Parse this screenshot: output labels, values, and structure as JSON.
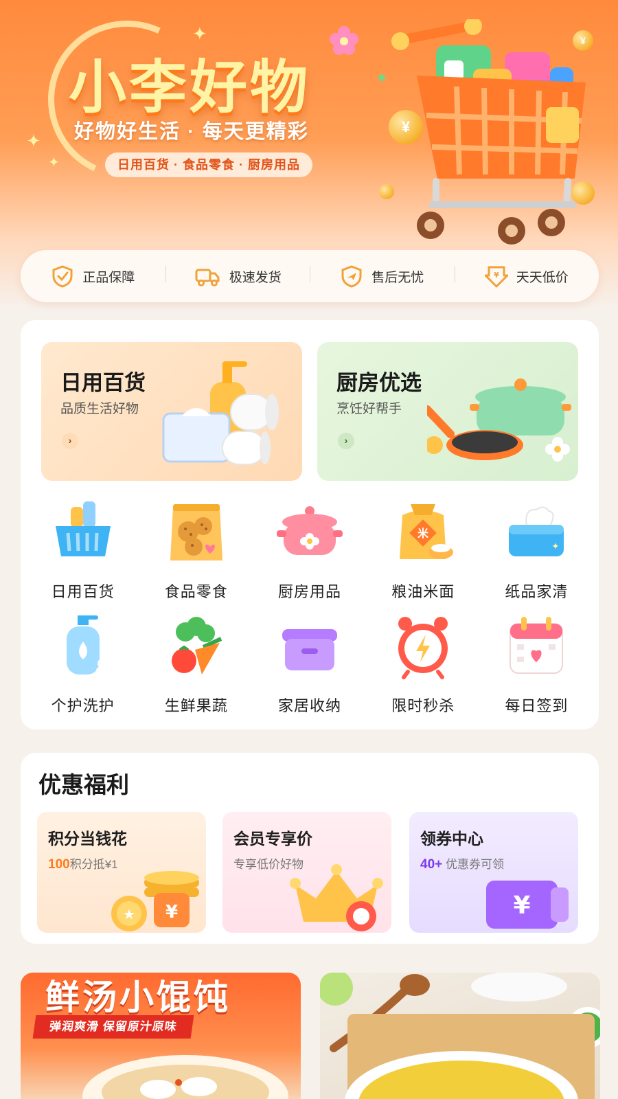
{
  "hero": {
    "title": "小李好物",
    "slogan": "好物好生活 · 每天更精彩",
    "tagline": "日用百货 · 食品零食 · 厨房用品",
    "coin_symbol": "¥"
  },
  "guarantees": [
    {
      "label": "正品保障",
      "icon": "shield-check-icon"
    },
    {
      "label": "极速发货",
      "icon": "truck-icon"
    },
    {
      "label": "售后无忧",
      "icon": "shield-plane-icon"
    },
    {
      "label": "天天低价",
      "icon": "price-down-icon"
    }
  ],
  "featured": [
    {
      "title": "日用百货",
      "subtitle": "品质生活好物",
      "arrow": "›"
    },
    {
      "title": "厨房优选",
      "subtitle": "烹饪好帮手",
      "arrow": "›"
    }
  ],
  "categories": [
    {
      "label": "日用百货",
      "icon": "basket-icon"
    },
    {
      "label": "食品零食",
      "icon": "cookie-bag-icon"
    },
    {
      "label": "厨房用品",
      "icon": "cooking-pot-icon"
    },
    {
      "label": "粮油米面",
      "icon": "rice-sack-icon"
    },
    {
      "label": "纸品家清",
      "icon": "tissue-box-icon"
    },
    {
      "label": "个护洗护",
      "icon": "pump-bottle-icon"
    },
    {
      "label": "生鲜果蔬",
      "icon": "vegetables-icon"
    },
    {
      "label": "家居收纳",
      "icon": "storage-box-icon"
    },
    {
      "label": "限时秒杀",
      "icon": "alarm-clock-icon"
    },
    {
      "label": "每日签到",
      "icon": "calendar-icon"
    }
  ],
  "benefits": {
    "title": "优惠福利",
    "items": [
      {
        "title": "积分当钱花",
        "highlight": "100",
        "subtitle": "积分抵¥1"
      },
      {
        "title": "会员专享价",
        "highlight": "",
        "subtitle": "专享低价好物"
      },
      {
        "title": "领券中心",
        "highlight": "40+",
        "subtitle": " 优惠券可领"
      }
    ]
  },
  "promos": {
    "left_title": "鲜汤小馄饨",
    "left_ribbon": "弹润爽滑 保留原汁原味"
  },
  "colors": {
    "brand_orange": "#ff8a3d",
    "accent_purple": "#7c3aed",
    "card_bg": "#ffffff",
    "page_bg": "#f7f1ec"
  }
}
